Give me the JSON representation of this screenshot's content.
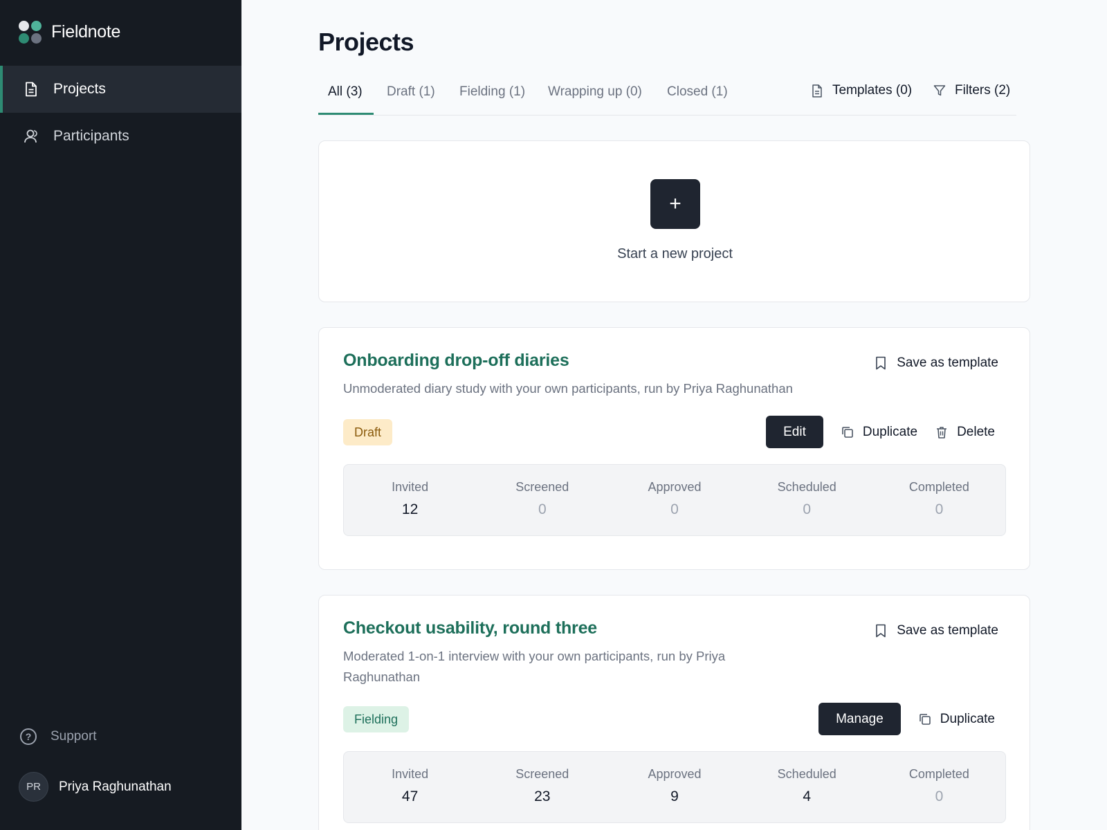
{
  "app": {
    "name": "Fieldnote"
  },
  "sidebar": {
    "items": [
      {
        "label": "Projects",
        "icon": "document-icon",
        "active": true
      },
      {
        "label": "Participants",
        "icon": "user-icon",
        "active": false
      }
    ],
    "support_label": "Support",
    "user": {
      "initials": "PR",
      "name": "Priya Raghunathan"
    }
  },
  "page": {
    "title": "Projects"
  },
  "tabs": [
    {
      "label": "All (3)",
      "active": true
    },
    {
      "label": "Draft (1)",
      "active": false
    },
    {
      "label": "Fielding (1)",
      "active": false
    },
    {
      "label": "Wrapping up (0)",
      "active": false
    },
    {
      "label": "Closed (1)",
      "active": false
    }
  ],
  "toolbar": {
    "templates_label": "Templates (0)",
    "filters_label": "Filters (2)"
  },
  "new_project": {
    "plus": "+",
    "label": "Start a new project"
  },
  "projects": [
    {
      "title": "Onboarding drop-off diaries",
      "description": "Unmoderated diary study with your own participants, run by Priya Raghunathan",
      "save_template_label": "Save as template",
      "status": "Draft",
      "primary_action": "Edit",
      "duplicate_label": "Duplicate",
      "delete_label": "Delete",
      "stats": [
        {
          "label": "Invited",
          "value": "12"
        },
        {
          "label": "Screened",
          "value": "0"
        },
        {
          "label": "Approved",
          "value": "0"
        },
        {
          "label": "Scheduled",
          "value": "0"
        },
        {
          "label": "Completed",
          "value": "0"
        }
      ]
    },
    {
      "title": "Checkout usability, round three",
      "description": "Moderated 1-on-1 interview with your own participants, run by Priya Raghunathan",
      "save_template_label": "Save as template",
      "status": "Fielding",
      "primary_action": "Manage",
      "duplicate_label": "Duplicate",
      "stats": [
        {
          "label": "Invited",
          "value": "47"
        },
        {
          "label": "Screened",
          "value": "23"
        },
        {
          "label": "Approved",
          "value": "9"
        },
        {
          "label": "Scheduled",
          "value": "4"
        },
        {
          "label": "Completed",
          "value": "0"
        }
      ]
    }
  ],
  "colors": {
    "accent": "#2e8b73",
    "sidebar_bg": "#161b22",
    "draft_badge": "#fdebc8",
    "fielding_badge": "#ddf2e6"
  }
}
